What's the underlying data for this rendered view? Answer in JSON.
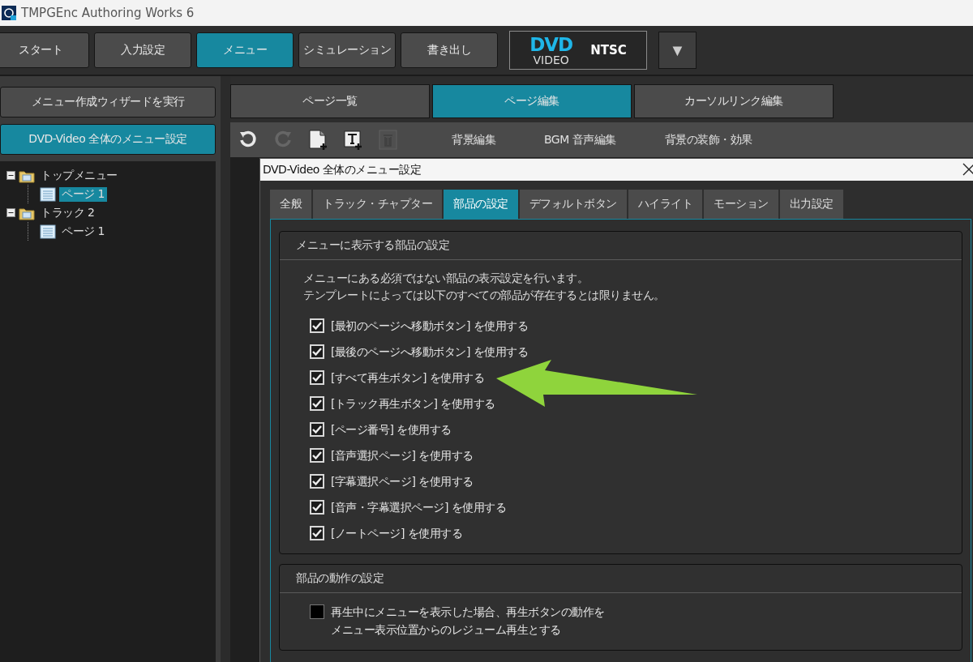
{
  "window": {
    "title": "TMPGEnc Authoring Works 6"
  },
  "nav": [
    {
      "label": "スタート",
      "selected": false
    },
    {
      "label": "入力設定",
      "selected": false
    },
    {
      "label": "メニュー",
      "selected": true
    },
    {
      "label": "シミュレーション",
      "selected": false
    },
    {
      "label": "書き出し",
      "selected": false
    }
  ],
  "format_badge": {
    "disc": "DVD",
    "sub": "VIDEO",
    "standard": "NTSC"
  },
  "format_dropdown": "▼",
  "sidebar": {
    "buttons": [
      {
        "label": "メニュー作成ウィザードを実行",
        "selected": false
      },
      {
        "label": "DVD-Video 全体のメニュー設定",
        "selected": true
      }
    ],
    "tree": [
      {
        "label": "トップメニュー",
        "kind": "folder",
        "expanded": true,
        "selected": false,
        "children": [
          {
            "label": "ページ 1",
            "kind": "page",
            "selected": true
          }
        ]
      },
      {
        "label": "トラック 2",
        "kind": "folder",
        "expanded": true,
        "selected": false,
        "children": [
          {
            "label": "ページ 1",
            "kind": "page",
            "selected": false
          }
        ]
      }
    ]
  },
  "editor_tabs": [
    {
      "label": "ページ一覧",
      "selected": false
    },
    {
      "label": "ページ編集",
      "selected": true
    },
    {
      "label": "カーソルリンク編集",
      "selected": false
    }
  ],
  "toolbar": {
    "icons": [
      {
        "kind": "undo",
        "disabled": false
      },
      {
        "kind": "redo",
        "disabled": true
      },
      {
        "kind": "add-page",
        "disabled": false
      },
      {
        "kind": "add-text",
        "disabled": false
      },
      {
        "kind": "trash",
        "disabled": true
      }
    ],
    "items": [
      "背景編集",
      "BGM 音声編集",
      "背景の装飾・効果"
    ]
  },
  "dialog": {
    "title": "DVD-Video 全体のメニュー設定",
    "tabs": [
      {
        "label": "全般",
        "selected": false
      },
      {
        "label": "トラック・チャプター",
        "selected": false
      },
      {
        "label": "部品の設定",
        "selected": true
      },
      {
        "label": "デフォルトボタン",
        "selected": false
      },
      {
        "label": "ハイライト",
        "selected": false
      },
      {
        "label": "モーション",
        "selected": false
      },
      {
        "label": "出力設定",
        "selected": false
      }
    ],
    "groups": [
      {
        "title": "メニューに表示する部品の設定",
        "description": [
          "メニューにある必須ではない部品の表示設定を行います。",
          "テンプレートによっては以下のすべての部品が存在するとは限りません。"
        ],
        "options": [
          {
            "label": "[最初のページへ移動ボタン] を使用する",
            "checked": true
          },
          {
            "label": "[最後のページへ移動ボタン] を使用する",
            "checked": true
          },
          {
            "label": "[すべて再生ボタン] を使用する",
            "checked": true
          },
          {
            "label": "[トラック再生ボタン] を使用する",
            "checked": true
          },
          {
            "label": "[ページ番号] を使用する",
            "checked": true
          },
          {
            "label": "[音声選択ページ] を使用する",
            "checked": true
          },
          {
            "label": "[字幕選択ページ] を使用する",
            "checked": true
          },
          {
            "label": "[音声・字幕選択ページ] を使用する",
            "checked": true
          },
          {
            "label": "[ノートページ] を使用する",
            "checked": true
          }
        ]
      },
      {
        "title": "部品の動作の設定",
        "options": [
          {
            "label": [
              "再生中にメニューを表示した場合、再生ボタンの動作を",
              "メニュー表示位置からのレジューム再生とする"
            ],
            "checked": false
          }
        ]
      }
    ]
  }
}
